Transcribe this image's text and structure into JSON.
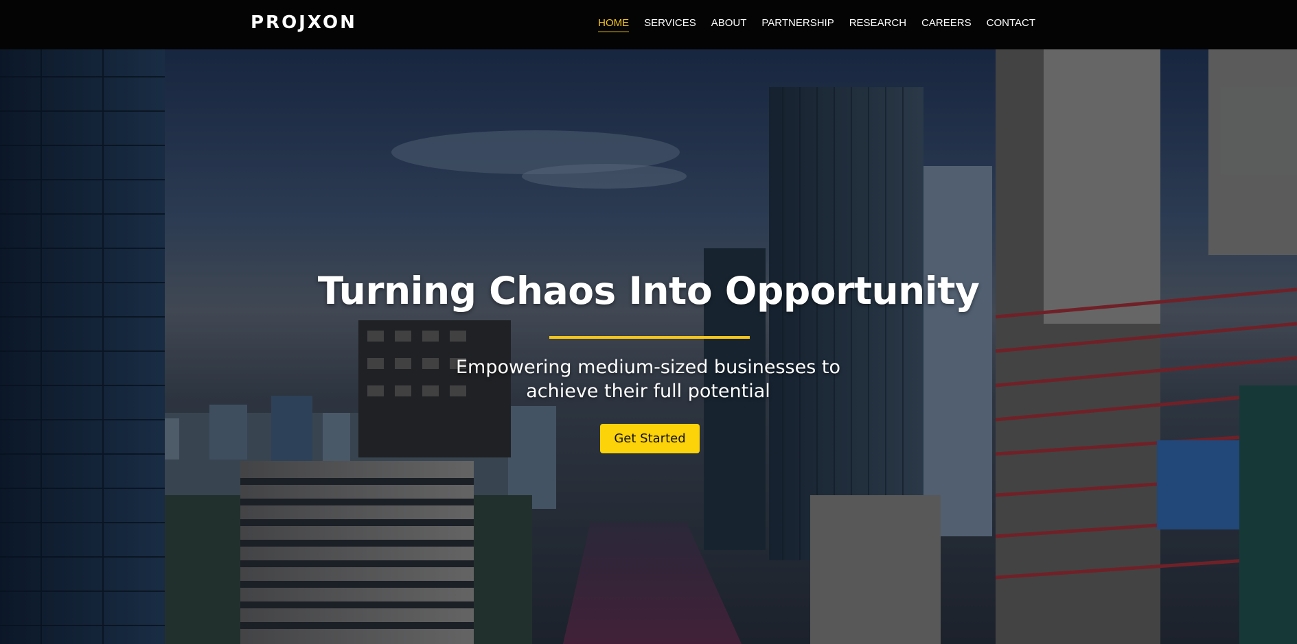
{
  "brand": {
    "logo_text": "PROJXON"
  },
  "nav": {
    "items": [
      {
        "label": "HOME",
        "active": true
      },
      {
        "label": "SERVICES"
      },
      {
        "label": "ABOUT"
      },
      {
        "label": "PARTNERSHIP"
      },
      {
        "label": "RESEARCH"
      },
      {
        "label": "CAREERS"
      },
      {
        "label": "CONTACT"
      }
    ]
  },
  "hero": {
    "title": "Turning Chaos Into Opportunity",
    "subtitle": "Empowering medium-sized businesses to achieve their full potential",
    "cta_label": "Get Started"
  },
  "colors": {
    "accent": "#f5c518",
    "button": "#fcd208",
    "navbar_bg": "#040404",
    "text": "#ffffff"
  }
}
